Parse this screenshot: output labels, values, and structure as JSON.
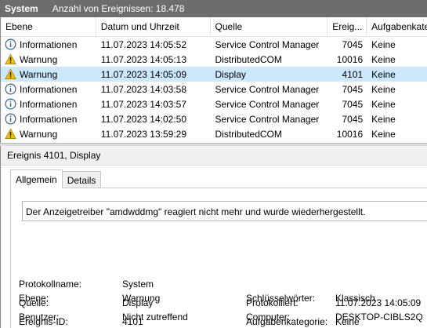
{
  "header": {
    "log_name": "System",
    "event_count": "Anzahl von Ereignissen: 18.478"
  },
  "columns": [
    "Ebene",
    "Datum und Uhrzeit",
    "Quelle",
    "Ereig...",
    "Aufgabenkate"
  ],
  "events": [
    {
      "level": "Informationen",
      "icon": "info-icon",
      "datetime": "11.07.2023 14:05:52",
      "source": "Service Control Manager",
      "id": "7045",
      "category": "Keine"
    },
    {
      "level": "Warnung",
      "icon": "warning-icon",
      "datetime": "11.07.2023 14:05:13",
      "source": "DistributedCOM",
      "id": "10016",
      "category": "Keine"
    },
    {
      "level": "Warnung",
      "icon": "warning-icon",
      "datetime": "11.07.2023 14:05:09",
      "source": "Display",
      "id": "4101",
      "category": "Keine"
    },
    {
      "level": "Informationen",
      "icon": "info-icon",
      "datetime": "11.07.2023 14:03:58",
      "source": "Service Control Manager",
      "id": "7045",
      "category": "Keine"
    },
    {
      "level": "Informationen",
      "icon": "info-icon",
      "datetime": "11.07.2023 14:03:57",
      "source": "Service Control Manager",
      "id": "7045",
      "category": "Keine"
    },
    {
      "level": "Informationen",
      "icon": "info-icon",
      "datetime": "11.07.2023 14:02:50",
      "source": "Service Control Manager",
      "id": "7045",
      "category": "Keine"
    },
    {
      "level": "Warnung",
      "icon": "warning-icon",
      "datetime": "11.07.2023 13:59:29",
      "source": "DistributedCOM",
      "id": "10016",
      "category": "Keine"
    }
  ],
  "selected_row": 2,
  "colors": {
    "selected_row_bg": "#cce8ff",
    "titlebar_bg": "#6d6d6d",
    "info_icon": "#3465a4",
    "warning_icon": "#f2c200"
  },
  "detail": {
    "title": "Ereignis 4101, Display",
    "tabs": [
      "Allgemein",
      "Details"
    ],
    "active_tab": "Allgemein",
    "description": "Der Anzeigetreiber \"amdwddmg\" reagiert nicht mehr und wurde wiederhergestellt.",
    "labels": {
      "log_name": "Protokollname:",
      "source": "Quelle:",
      "event_id": "Ereignis-ID:",
      "level": "Ebene:",
      "user": "Benutzer:",
      "logged": "Protokolliert:",
      "task_category": "Aufgabenkategorie:",
      "keywords": "Schlüsselwörter:",
      "computer": "Computer:"
    },
    "values": {
      "log_name": "System",
      "source": "Display",
      "event_id": "4101",
      "level": "Warnung",
      "user": "Nicht zutreffend",
      "logged": "11.07.2023 14:05:09",
      "task_category": "Keine",
      "keywords": "Klassisch",
      "computer": "DESKTOP-CIBLS2Q"
    }
  }
}
